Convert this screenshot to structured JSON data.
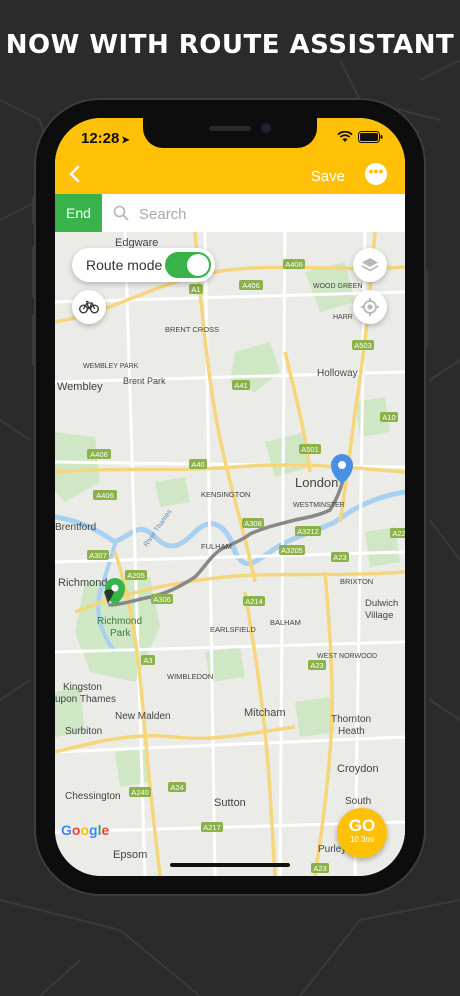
{
  "headline": "NOW WITH ROUTE ASSISTANT",
  "status": {
    "time": "12:28",
    "location_glyph": "➤"
  },
  "nav": {
    "back_icon": "chevron-left-icon",
    "save_label": "Save",
    "more_icon": "ellipsis-icon"
  },
  "search": {
    "end_label": "End",
    "placeholder": "Search",
    "value": ""
  },
  "route_mode": {
    "label": "Route mode",
    "enabled": true
  },
  "map": {
    "places": {
      "edgware": "Edgware",
      "brent_cross": "BRENT CROSS",
      "wembley_park": "WEMBLEY PARK",
      "wembley": "Wembley",
      "brent_park": "Brent Park",
      "wood_green": "WOOD GREEN",
      "harr": "HARR",
      "holloway": "Holloway",
      "kensington": "KENSINGTON",
      "london": "London",
      "westminster": "WESTMINSTER",
      "brentford": "Brentford",
      "fulham": "FULHAM",
      "richmond": "Richmond",
      "richmond_park": "Richmond\nPark",
      "brixton": "BRIXTON",
      "dulwich_village": "Dulwich\nVillage",
      "earlsfield": "EARLSFIELD",
      "balham": "BALHAM",
      "west_norwood": "WEST NORWOOD",
      "wimbledon": "WIMBLEDON",
      "kingston": "Kingston\nupon Thames",
      "new_malden": "New Malden",
      "mitcham": "Mitcham",
      "thornton_heath": "Thornton\nHeath",
      "surbiton": "Surbiton",
      "croydon": "Croydon",
      "chessington": "Chessington",
      "sutton": "Sutton",
      "south": "South",
      "purley": "Purley",
      "epsom": "Epsom",
      "river_thames": "River Thames"
    },
    "roads": [
      "A406",
      "A1",
      "A406",
      "A503",
      "A41",
      "A10",
      "A406",
      "A40",
      "A501",
      "A406",
      "A308",
      "A3212",
      "A3205",
      "A23",
      "A307",
      "A205",
      "A306",
      "A214",
      "A3",
      "A23",
      "A24",
      "A240",
      "A217",
      "A23",
      "A22"
    ],
    "attribution": "Google",
    "start_marker_color": "#37b34a",
    "end_marker_color": "#4a90e2",
    "route_color": "#888888"
  },
  "go": {
    "label": "GO",
    "distance": "10.3mi"
  },
  "colors": {
    "accent": "#ffc107",
    "green": "#37b34a",
    "background": "#2b2b2b"
  }
}
